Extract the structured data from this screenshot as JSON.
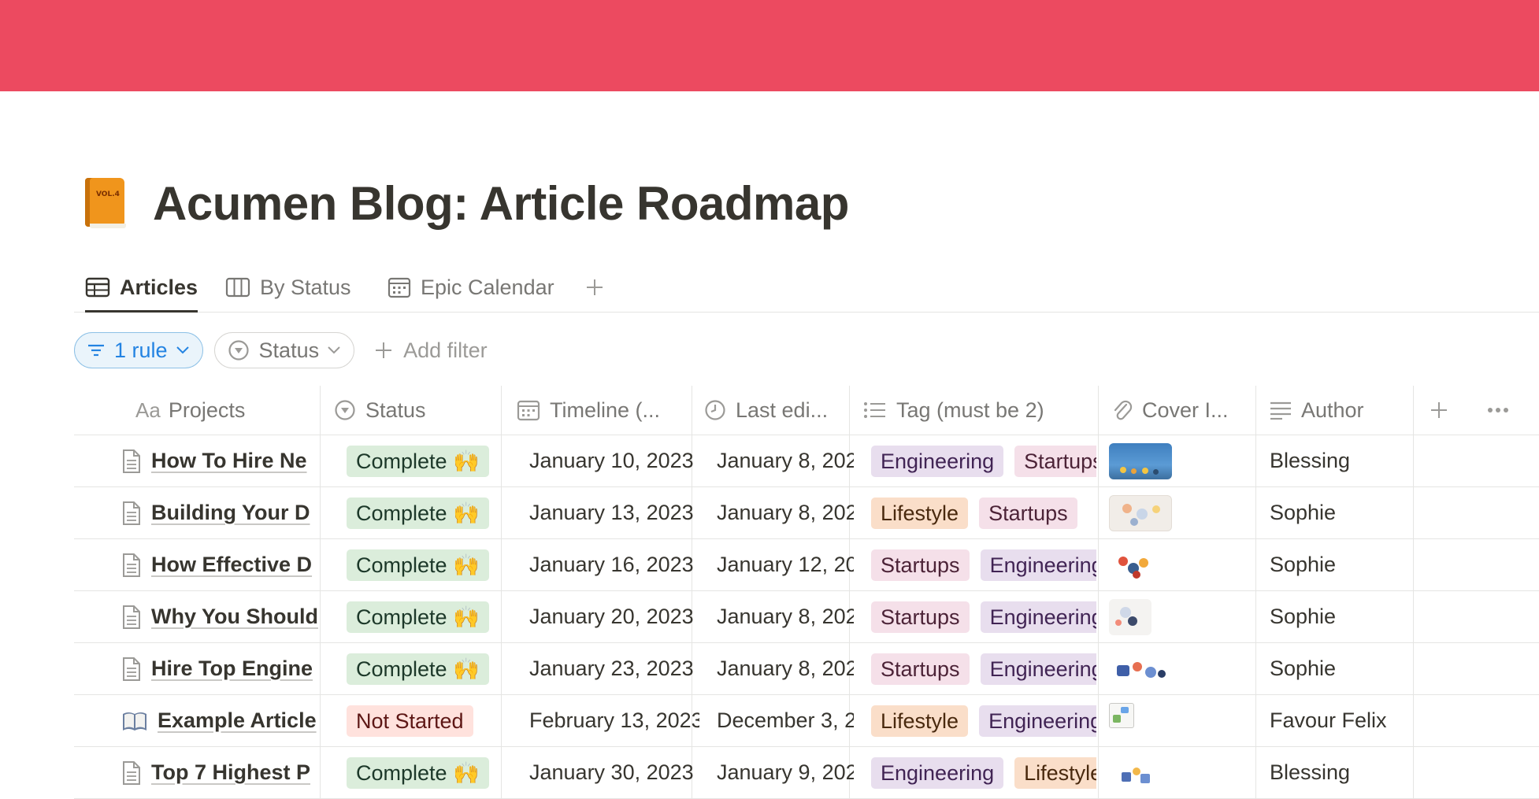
{
  "page": {
    "title": "Acumen Blog: Article Roadmap",
    "icon": "orange-book-icon",
    "icon_text": "VOL.4",
    "banner_color": "#ec4a60"
  },
  "tabs": [
    {
      "label": "Articles",
      "icon": "table-icon",
      "active": true
    },
    {
      "label": "By Status",
      "icon": "board-icon",
      "active": false
    },
    {
      "label": "Epic Calendar",
      "icon": "calendar-icon",
      "active": false
    }
  ],
  "filters": {
    "rule_label": "1 rule",
    "status_label": "Status",
    "add_filter_label": "Add filter"
  },
  "columns": {
    "projects": "Projects",
    "status": "Status",
    "timeline": "Timeline (...",
    "last_edited": "Last edi...",
    "tag": "Tag (must be 2)",
    "cover": "Cover I...",
    "author": "Author"
  },
  "rows": [
    {
      "title": "How To Hire Ne",
      "icon": "document-icon",
      "status": "Complete 🙌",
      "timeline": "January 10, 2023",
      "edited": "January 8, 202",
      "tags": [
        "Engineering",
        "Startups"
      ],
      "author": "Blessing"
    },
    {
      "title": "Building Your D",
      "icon": "document-icon",
      "status": "Complete 🙌",
      "timeline": "January 13, 2023",
      "edited": "January 8, 202",
      "tags": [
        "Lifestyle",
        "Startups"
      ],
      "author": "Sophie"
    },
    {
      "title": "How Effective D",
      "icon": "document-icon",
      "status": "Complete 🙌",
      "timeline": "January 16, 2023",
      "edited": "January 12, 20",
      "tags": [
        "Startups",
        "Engineering"
      ],
      "author": "Sophie"
    },
    {
      "title": "Why You Should",
      "icon": "document-icon",
      "status": "Complete 🙌",
      "timeline": "January 20, 2023",
      "edited": "January 8, 202",
      "tags": [
        "Startups",
        "Engineering"
      ],
      "author": "Sophie"
    },
    {
      "title": "Hire Top Engine",
      "icon": "document-icon",
      "status": "Complete 🙌",
      "timeline": "January 23, 2023",
      "edited": "January 8, 202",
      "tags": [
        "Startups",
        "Engineering"
      ],
      "author": "Sophie"
    },
    {
      "title": "Example Article",
      "icon": "open-book-icon",
      "status": "Not Started",
      "timeline": "February 13, 2023",
      "edited": "December 3, 2",
      "tags": [
        "Lifestyle",
        "Engineering"
      ],
      "author": "Favour Felix"
    },
    {
      "title": "Top 7 Highest P",
      "icon": "document-icon",
      "status": "Complete 🙌",
      "timeline": "January 30, 2023",
      "edited": "January 9, 202",
      "tags": [
        "Engineering",
        "Lifestyle"
      ],
      "author": "Blessing"
    }
  ],
  "colors": {
    "complete_bg": "#dbeddb",
    "not_started_bg": "#ffe2dd",
    "engineering_bg": "#e8deee",
    "startups_bg": "#f5e0e9",
    "lifestyle_bg": "#fadec9",
    "filter_accent": "#2383e2"
  }
}
